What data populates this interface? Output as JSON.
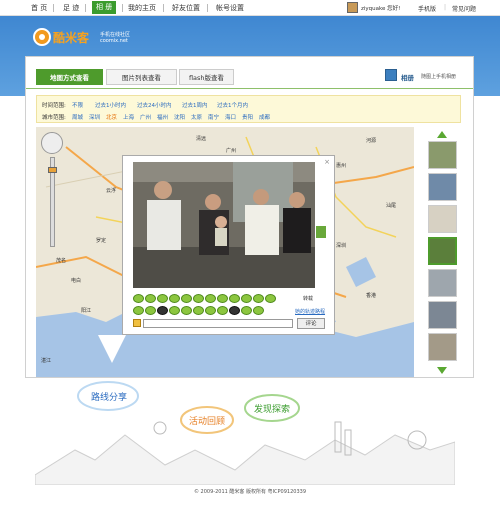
{
  "nav": {
    "items": [
      "首 页",
      "足 迹",
      "相 册",
      "我的主页",
      "好友位置",
      "帐号设置"
    ],
    "active_index": 2,
    "user": "ziyquake 您好!",
    "right_links": [
      "手机版",
      "常见问题"
    ]
  },
  "brand": {
    "name": "酷米客",
    "tagline": "手机在线社区",
    "url": "coomix.net"
  },
  "tabs": [
    "地图方式查看",
    "图片列表查看",
    "flash版查看"
  ],
  "album": {
    "label": "相册",
    "tip": "随图上手机相册"
  },
  "filter": {
    "time_label": "时间范围:",
    "time_options": [
      "不限",
      "过去1小时内",
      "过去24小时内",
      "过去1周内",
      "过去1个月内"
    ],
    "city_label": "城市范围:",
    "city_options": [
      "周城",
      "深圳",
      "北京",
      "上海",
      "广州",
      "福州",
      "沈阳",
      "太原",
      "南宁",
      "海口",
      "贵阳",
      "成都"
    ],
    "city_selected": "北京"
  },
  "map_labels": [
    "惠州",
    "东莞",
    "深圳",
    "香港",
    "珠海",
    "中山",
    "阳江",
    "云浮",
    "江门",
    "台山",
    "佛山",
    "广州",
    "湛江",
    "茂名",
    "电白",
    "汕尾",
    "清远",
    "河源",
    "罗定"
  ],
  "popup": {
    "send_label": "转载",
    "trip_link": "她的轨迹路程",
    "comment_button": "评论",
    "emoji_count_row1": 13,
    "emoji_count_row2": 13
  },
  "illustration": {
    "labels": [
      "路线分享",
      "活动回顾",
      "发现探索"
    ]
  },
  "footer": "© 2009-2011 酷米客 版权所有 粤ICP09120339",
  "colors": {
    "banner": "#4a93d8",
    "accent_green": "#4e9b2c",
    "logo_orange": "#f29a1f"
  },
  "icons": [
    "map-pan-control-icon",
    "zoom-slider-icon",
    "album-icon",
    "next-photo-icon",
    "thumb-up-arrow-icon",
    "thumb-down-arrow-icon",
    "close-icon"
  ]
}
